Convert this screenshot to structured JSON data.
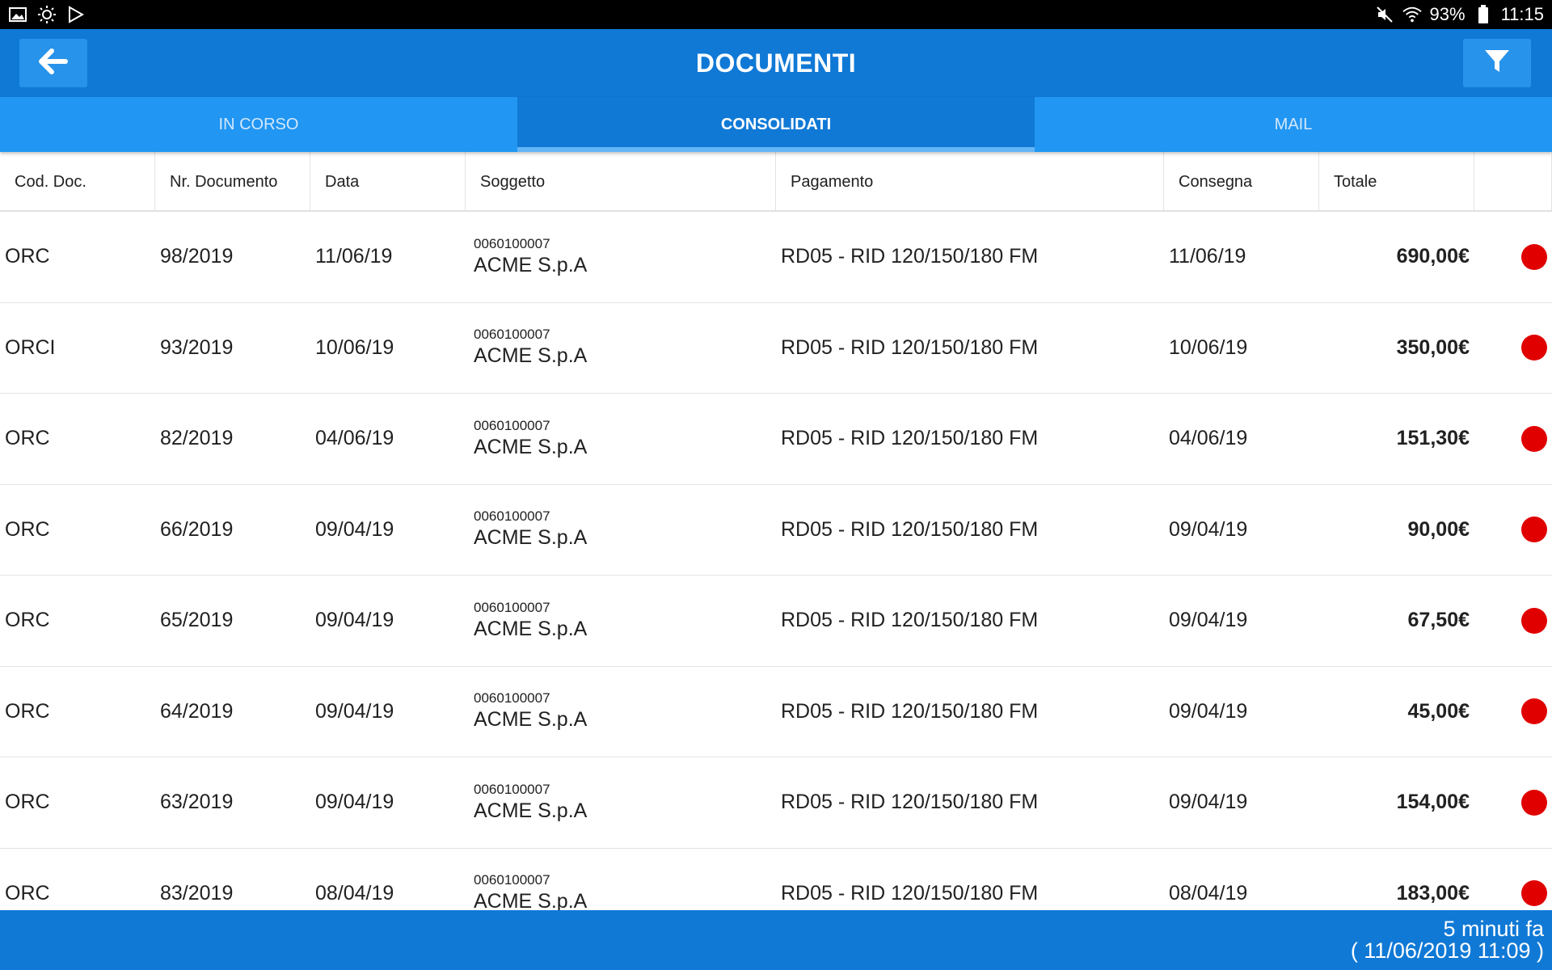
{
  "status_bar": {
    "left_icons": [
      "image-icon",
      "brightness-icon",
      "play-store-icon"
    ],
    "battery": "93%",
    "time": "11:15"
  },
  "header": {
    "title": "DOCUMENTI",
    "back_icon": "arrow-left-icon",
    "filter_icon": "filter-icon"
  },
  "tabs": [
    {
      "label": "IN CORSO",
      "active": false
    },
    {
      "label": "CONSOLIDATI",
      "active": true
    },
    {
      "label": "MAIL",
      "active": false
    }
  ],
  "table": {
    "columns": [
      "Cod. Doc.",
      "Nr. Documento",
      "Data",
      "Soggetto",
      "Pagamento",
      "Consegna",
      "Totale",
      ""
    ],
    "rows": [
      {
        "cod": "ORC",
        "nr": "98/2019",
        "data": "11/06/19",
        "subject_code": "0060100007",
        "subject_name": "ACME S.p.A",
        "pagamento": "RD05 - RID 120/150/180 FM",
        "consegna": "11/06/19",
        "totale": "690,00€",
        "status_color": "#e00000"
      },
      {
        "cod": "ORCI",
        "nr": "93/2019",
        "data": "10/06/19",
        "subject_code": "0060100007",
        "subject_name": "ACME S.p.A",
        "pagamento": "RD05 - RID 120/150/180 FM",
        "consegna": "10/06/19",
        "totale": "350,00€",
        "status_color": "#e00000"
      },
      {
        "cod": "ORC",
        "nr": "82/2019",
        "data": "04/06/19",
        "subject_code": "0060100007",
        "subject_name": "ACME S.p.A",
        "pagamento": "RD05 - RID 120/150/180 FM",
        "consegna": "04/06/19",
        "totale": "151,30€",
        "status_color": "#e00000"
      },
      {
        "cod": "ORC",
        "nr": "66/2019",
        "data": "09/04/19",
        "subject_code": "0060100007",
        "subject_name": "ACME S.p.A",
        "pagamento": "RD05 - RID 120/150/180 FM",
        "consegna": "09/04/19",
        "totale": "90,00€",
        "status_color": "#e00000"
      },
      {
        "cod": "ORC",
        "nr": "65/2019",
        "data": "09/04/19",
        "subject_code": "0060100007",
        "subject_name": "ACME S.p.A",
        "pagamento": "RD05 - RID 120/150/180 FM",
        "consegna": "09/04/19",
        "totale": "67,50€",
        "status_color": "#e00000"
      },
      {
        "cod": "ORC",
        "nr": "64/2019",
        "data": "09/04/19",
        "subject_code": "0060100007",
        "subject_name": "ACME S.p.A",
        "pagamento": "RD05 - RID 120/150/180 FM",
        "consegna": "09/04/19",
        "totale": "45,00€",
        "status_color": "#e00000"
      },
      {
        "cod": "ORC",
        "nr": "63/2019",
        "data": "09/04/19",
        "subject_code": "0060100007",
        "subject_name": "ACME S.p.A",
        "pagamento": "RD05 - RID 120/150/180 FM",
        "consegna": "09/04/19",
        "totale": "154,00€",
        "status_color": "#e00000"
      },
      {
        "cod": "ORC",
        "nr": "83/2019",
        "data": "08/04/19",
        "subject_code": "0060100007",
        "subject_name": "ACME S.p.A",
        "pagamento": "RD05 - RID 120/150/180 FM",
        "consegna": "08/04/19",
        "totale": "183,00€",
        "status_color": "#e00000"
      }
    ]
  },
  "footer": {
    "relative_time": "5 minuti fa",
    "absolute_time": "( 11/06/2019 11:09 )"
  },
  "colors": {
    "primary": "#1079d6",
    "tab_bar": "#2196f3",
    "status_dot": "#e00000"
  }
}
